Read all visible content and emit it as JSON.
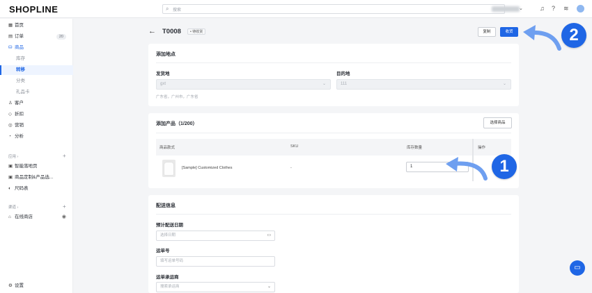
{
  "topbar": {
    "logo": "SHOPLINE",
    "search_placeholder": "搜索",
    "icons": [
      "search-icon",
      "chevron-down-icon",
      "bell-icon",
      "help-icon",
      "wifi-icon",
      "avatar"
    ]
  },
  "sidebar": {
    "items": [
      {
        "label": "首页",
        "icon": "home-icon"
      },
      {
        "label": "订单",
        "icon": "order-icon",
        "badge": "20"
      },
      {
        "label": "商品",
        "icon": "bag-icon"
      },
      {
        "label": "库存"
      },
      {
        "label": "转移"
      },
      {
        "label": "分类"
      },
      {
        "label": "礼品卡"
      },
      {
        "label": "客户",
        "icon": "user-icon"
      },
      {
        "label": "折扣",
        "icon": "tag-icon"
      },
      {
        "label": "营销",
        "icon": "marketing-icon"
      },
      {
        "label": "分析",
        "icon": "analytics-icon"
      }
    ],
    "apps_group": "应用",
    "apps": [
      {
        "label": "智能落地页"
      },
      {
        "label": "商品定制&产品选..."
      },
      {
        "label": "尺码表"
      }
    ],
    "channels_group": "渠道",
    "channels": [
      {
        "label": "在线商店"
      }
    ],
    "settings": "设置"
  },
  "header": {
    "title": "T0008",
    "status": "待收货",
    "copy_button": "复制",
    "receive_button": "收货"
  },
  "location": {
    "title": "添加地点",
    "origin_label": "发货地",
    "origin_value": "gxt",
    "origin_address": "广东省，广州市，广东省",
    "destination_label": "目的地",
    "destination_value": "111"
  },
  "products": {
    "title": "添加产品（1/200）",
    "select_button": "选择商品",
    "columns": [
      "商品款式",
      "SKU",
      "库存数量",
      "操作"
    ],
    "rows": [
      {
        "name": "[Sample] Customized Clothes",
        "sku": "-",
        "qty": "1"
      }
    ]
  },
  "shipping": {
    "title": "配送信息",
    "date_label": "预计配送日期",
    "date_placeholder": "选择日期",
    "tracking_label": "运单号",
    "tracking_placeholder": "填写运单号码",
    "carrier_label": "运单承运商",
    "carrier_placeholder": "搜索承运商"
  },
  "callouts": [
    "1",
    "2"
  ],
  "colors": {
    "accent": "#1f66e5",
    "page_bg": "#f4f5f7"
  }
}
